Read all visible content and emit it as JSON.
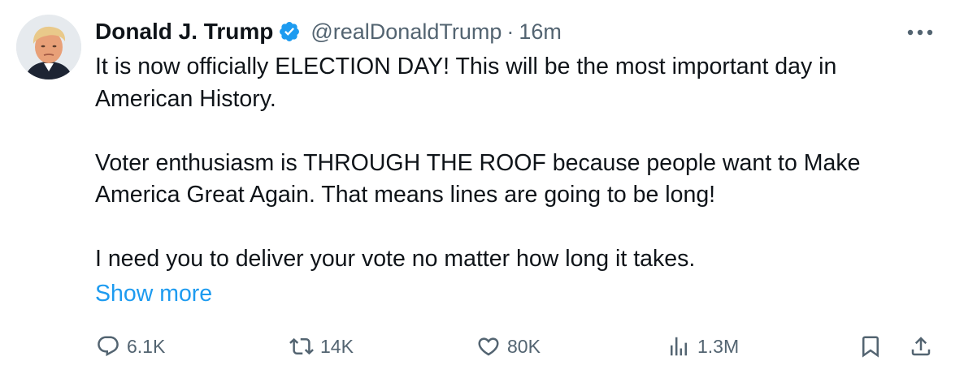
{
  "tweet": {
    "author": {
      "display_name": "Donald J. Trump",
      "handle": "@realDonaldTrump",
      "verified": true,
      "avatar": "profile-photo"
    },
    "separator": "·",
    "time": "16m",
    "menu_icon": "more-horizontal-icon",
    "text": {
      "para1": "It is now officially ELECTION DAY! This will be the most important day in American History.",
      "para2": "Voter enthusiasm is THROUGH THE ROOF because people want to Make America Great Again. That means lines are going to be long!",
      "para3": "I need you to deliver your vote no matter how long it takes."
    },
    "show_more": "Show more",
    "actions": {
      "replies": "6.1K",
      "retweets": "14K",
      "likes": "80K",
      "views": "1.3M"
    },
    "colors": {
      "accent": "#1d9bf0",
      "text": "#0f1419",
      "secondary": "#536471"
    }
  }
}
